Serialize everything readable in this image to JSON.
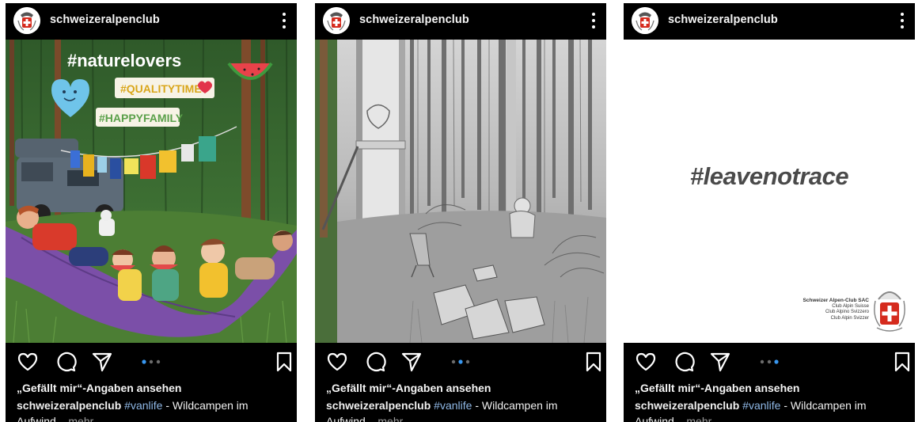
{
  "posts": [
    {
      "username": "schweizeralpenclub",
      "likes_text": "„Gefällt mir“-Angaben ansehen",
      "caption_user": "schweizeralpenclub",
      "caption_tag": "#vanlife",
      "caption_text": " - Wildcampen im Aufwind",
      "caption_more_prefix": "...",
      "caption_more": "mehr",
      "image_hashtags": [
        "#naturelovers",
        "#QUALITYTIME",
        "#HAPPYFAMILY"
      ],
      "active_dot": 0
    },
    {
      "username": "schweizeralpenclub",
      "likes_text": "„Gefällt mir“-Angaben ansehen",
      "caption_user": "schweizeralpenclub",
      "caption_tag": "#vanlife",
      "caption_text": " - Wildcampen im Aufwind",
      "caption_more_prefix": "...",
      "caption_more": "mehr",
      "active_dot": 1
    },
    {
      "username": "schweizeralpenclub",
      "likes_text": "„Gefällt mir“-Angaben ansehen",
      "caption_user": "schweizeralpenclub",
      "caption_tag": "#vanlife",
      "caption_text": " - Wildcampen im Aufwind",
      "caption_more_prefix": "...",
      "caption_more": "mehr",
      "image_hashtag": "#leavenotrace",
      "sac_lines": [
        "Schweizer Alpen-Club SAC",
        "Club Alpin Suisse",
        "Club Alpino Svizzero",
        "Club Alpin Svizzer"
      ],
      "active_dot": 2
    }
  ],
  "icons": [
    "heart-icon",
    "comment-icon",
    "share-icon",
    "bookmark-icon",
    "more-icon",
    "carousel-dots"
  ],
  "colors": {
    "panel_bg": "#000000",
    "hashtag_link": "#8fb8e6",
    "dot_active": "#3897f0",
    "dot_inactive": "#6b6b6b"
  }
}
